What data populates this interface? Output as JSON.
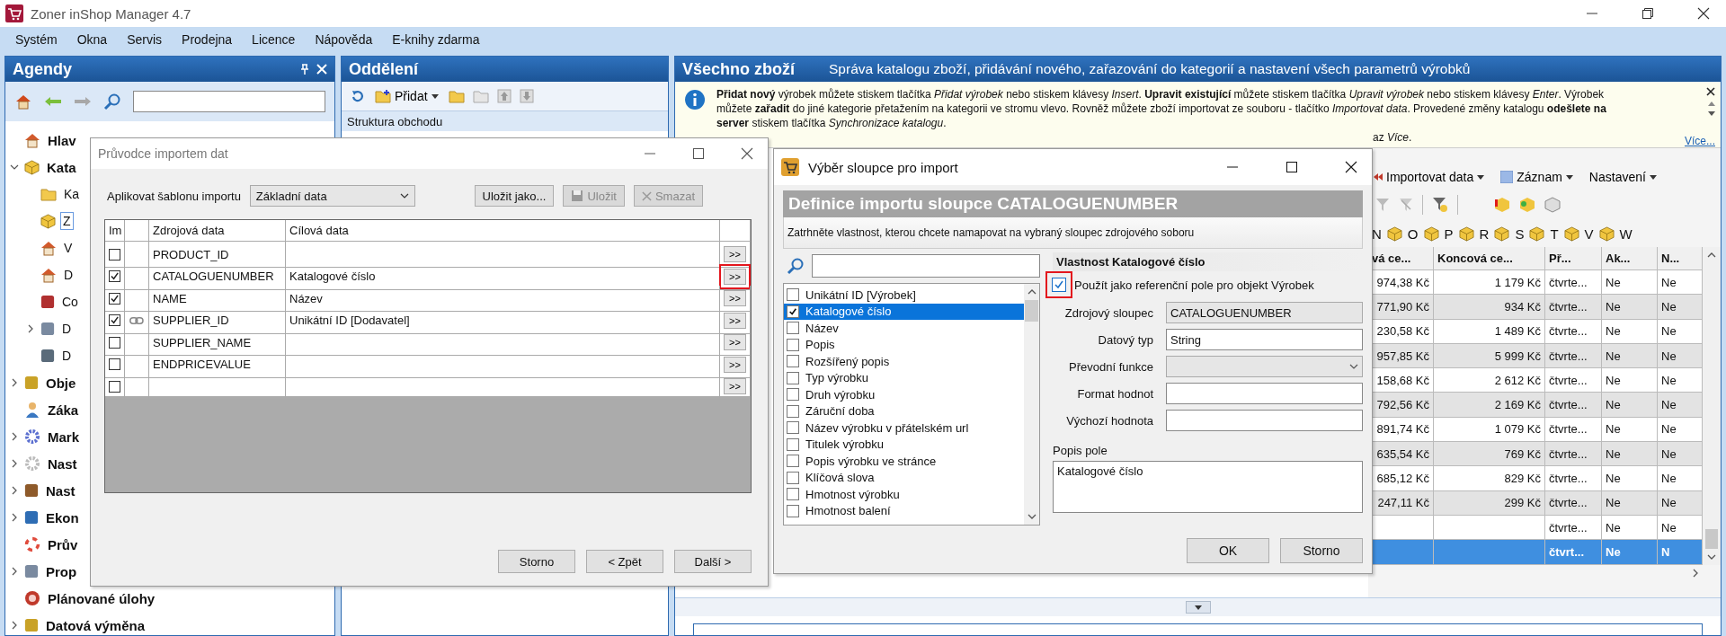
{
  "window": {
    "title": "Zoner inShop Manager 4.7"
  },
  "menu": [
    "Systém",
    "Okna",
    "Servis",
    "Prodejna",
    "Licence",
    "Nápověda",
    "E-knihy zdarma"
  ],
  "agendy": {
    "title": "Agendy",
    "tree": [
      {
        "label": "Hlav",
        "selected": false
      },
      {
        "label": "Kata",
        "expanded": true,
        "selected": false,
        "children": [
          {
            "label": "Ka",
            "selected": false
          },
          {
            "label": "Z",
            "selected": true
          },
          {
            "label": "V",
            "selected": false
          },
          {
            "label": "D",
            "selected": false
          },
          {
            "label": "Co",
            "selected": false
          },
          {
            "label": "D",
            "expanded": false,
            "selected": false
          },
          {
            "label": "D",
            "selected": false
          }
        ]
      },
      {
        "label": "Obje",
        "expanded": false,
        "selected": false
      },
      {
        "label": "Záka",
        "selected": false
      },
      {
        "label": "Mark",
        "expanded": false,
        "selected": false
      },
      {
        "label": "Nast",
        "expanded": false,
        "selected": false
      },
      {
        "label": "Nast",
        "expanded": false,
        "selected": false
      },
      {
        "label": "Ekon",
        "expanded": false,
        "selected": false
      },
      {
        "label": "Prův",
        "selected": false
      },
      {
        "label": "Prop",
        "expanded": false,
        "selected": false
      },
      {
        "label": "Plánované úlohy",
        "selected": false
      },
      {
        "label": "Datová výměna",
        "expanded": false,
        "selected": false
      }
    ]
  },
  "oddeleni": {
    "title": "Oddělení",
    "add_button": "Přidat",
    "section": "Struktura obchodu"
  },
  "catalog": {
    "title": "Všechno zboží",
    "subtitle": "Správa katalogu zboží, přidávání nového, zařazování do kategorií a nastavení všech parametrů výrobků",
    "info": "**Přidat nový** výrobek můžete stiskem tlačítka *Přidat výrobek* nebo stiskem klávesy *Insert*. **Upravit existující** můžete stiskem tlačítka *Upravit výrobek* nebo stiskem klávesy *Enter*. Výrobek můžete **zařadit** do jiné kategorie přetažením na kategorii ve stromu vlevo. Rovněž můžete zboží importovat ze souboru - tlačítko *Importovat data*.  Provedené změny katalogu **odešlete na server** stiskem tlačítka *Synchronizace katalogu*.",
    "info_tail": "az *Více*.",
    "more_link": "Více...",
    "toolbar": [
      "Importovat data",
      "Záznam",
      "Nastavení"
    ],
    "letters": [
      "N",
      "O",
      "P",
      "R",
      "S",
      "T",
      "V",
      "W"
    ],
    "table": {
      "columns": [
        "vá ce...",
        "Koncová ce...",
        "Př...",
        "Ak...",
        "N..."
      ],
      "rows": [
        {
          "cells": [
            "974,38 Kč",
            "1 179 Kč",
            "čtvrte...",
            "Ne",
            "Ne"
          ],
          "selected": false
        },
        {
          "cells": [
            "771,90 Kč",
            "934 Kč",
            "čtvrte...",
            "Ne",
            "Ne"
          ],
          "selected": false
        },
        {
          "cells": [
            "230,58 Kč",
            "1 489 Kč",
            "čtvrte...",
            "Ne",
            "Ne"
          ],
          "selected": false
        },
        {
          "cells": [
            "957,85 Kč",
            "5 999 Kč",
            "čtvrte...",
            "Ne",
            "Ne"
          ],
          "selected": false
        },
        {
          "cells": [
            "158,68 Kč",
            "2 612 Kč",
            "čtvrte...",
            "Ne",
            "Ne"
          ],
          "selected": false
        },
        {
          "cells": [
            "792,56 Kč",
            "2 169 Kč",
            "čtvrte...",
            "Ne",
            "Ne"
          ],
          "selected": false
        },
        {
          "cells": [
            "891,74 Kč",
            "1 079 Kč",
            "čtvrte...",
            "Ne",
            "Ne"
          ],
          "selected": false
        },
        {
          "cells": [
            "635,54 Kč",
            "769 Kč",
            "čtvrte...",
            "Ne",
            "Ne"
          ],
          "selected": false
        },
        {
          "cells": [
            "685,12 Kč",
            "829 Kč",
            "čtvrte...",
            "Ne",
            "Ne"
          ],
          "selected": false
        },
        {
          "cells": [
            "247,11 Kč",
            "299 Kč",
            "čtvrte...",
            "Ne",
            "Ne"
          ],
          "selected": false
        },
        {
          "cells": [
            null,
            null,
            "čtvrte...",
            "Ne",
            "Ne"
          ],
          "selected": false
        },
        {
          "cells": [
            null,
            null,
            "čtvrt...",
            "Ne",
            "N"
          ],
          "selected": true
        }
      ]
    }
  },
  "import_wizard": {
    "title": "Průvodce importem dat",
    "template_label": "Aplikovat šablonu importu",
    "template": "Základní data",
    "buttons": [
      {
        "label": "Uložit jako...",
        "disabled": false
      },
      {
        "label": "Uložit",
        "disabled": true
      },
      {
        "label": "Smazat",
        "disabled": true
      }
    ],
    "columns": [
      "Im",
      "Zdrojová data",
      "Cílová data"
    ],
    "rows": [
      {
        "checked": false,
        "linked": false,
        "source": "PRODUCT_ID",
        "map": ">>",
        "highlighted": false
      },
      {
        "checked": true,
        "linked": false,
        "source": "CATALOGUENUMBER",
        "target": "Katalogové číslo",
        "map": ">>",
        "highlighted": true
      },
      {
        "checked": true,
        "linked": false,
        "source": "NAME",
        "target": "Název",
        "map": ">>",
        "highlighted": false
      },
      {
        "checked": true,
        "linked": true,
        "source": "SUPPLIER_ID",
        "target": "Unikátní ID [Dodavatel]",
        "map": ">>",
        "highlighted": false
      },
      {
        "checked": false,
        "linked": false,
        "source": "SUPPLIER_NAME",
        "map": ">>",
        "highlighted": false
      },
      {
        "checked": false,
        "linked": false,
        "source": "ENDPRICEVALUE",
        "map": ">>",
        "highlighted": false
      },
      {
        "checked": false,
        "linked": false,
        "map": ">>",
        "highlighted": false
      }
    ],
    "footer": [
      "Storno",
      "< Zpět",
      "Další >"
    ]
  },
  "column_picker": {
    "title": "Výběr sloupce pro import",
    "heading": "Definice importu sloupce CATALOGUENUMBER",
    "instruction": "Zatrhněte vlastnost, kterou chcete namapovat na vybraný sloupec zdrojového soboru",
    "properties": [
      {
        "label": "Unikátní ID [Výrobek]",
        "checked": false,
        "selected": false
      },
      {
        "label": "Katalogové číslo",
        "checked": true,
        "selected": true
      },
      {
        "label": "Název",
        "checked": false,
        "selected": false
      },
      {
        "label": "Popis",
        "checked": false,
        "selected": false
      },
      {
        "label": "Rozšířený popis",
        "checked": false,
        "selected": false
      },
      {
        "label": "Typ výrobku",
        "checked": false,
        "selected": false
      },
      {
        "label": "Druh výrobku",
        "checked": false,
        "selected": false
      },
      {
        "label": "Záruční doba",
        "checked": false,
        "selected": false
      },
      {
        "label": "Název výrobku v přátelském url",
        "checked": false,
        "selected": false
      },
      {
        "label": "Titulek výrobku",
        "checked": false,
        "selected": false
      },
      {
        "label": "Popis výrobku ve stránce",
        "checked": false,
        "selected": false
      },
      {
        "label": "Klíčová slova",
        "checked": false,
        "selected": false
      },
      {
        "label": "Hmotnost výrobku",
        "checked": false,
        "selected": false
      },
      {
        "label": "Hmotnost balení",
        "checked": false,
        "selected": false
      }
    ],
    "detail": {
      "title": "Vlastnost Katalogové číslo",
      "reference": {
        "label": "Použít jako referenční pole pro objekt Výrobek",
        "checked": true,
        "highlighted": true
      },
      "fields": [
        {
          "label": "Zdrojový sloupec",
          "kind": "readonly",
          "value": "CATALOGUENUMBER"
        },
        {
          "label": "Datový typ",
          "kind": "text",
          "value": "String"
        },
        {
          "label": "Převodní funkce",
          "kind": "select"
        },
        {
          "label": "Format hodnot",
          "kind": "text"
        },
        {
          "label": "Výchozí hodnota",
          "kind": "text"
        }
      ],
      "description_label": "Popis pole",
      "description": "Katalogové číslo"
    },
    "buttons": [
      "OK",
      "Storno"
    ]
  }
}
